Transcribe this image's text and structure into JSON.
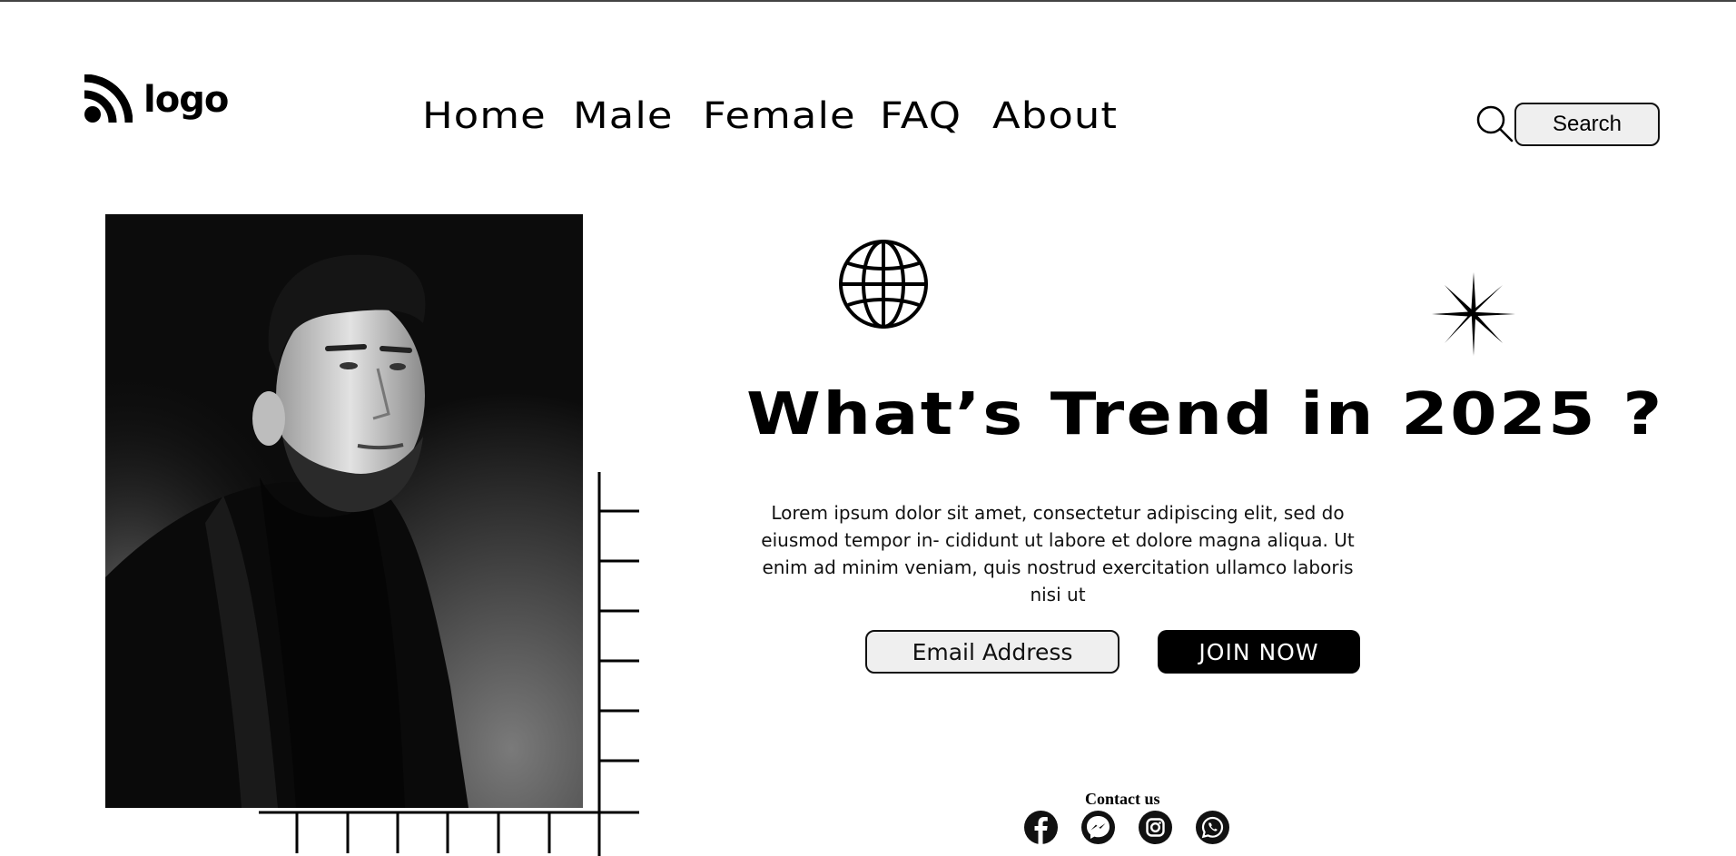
{
  "brand": {
    "logo_text": "logo"
  },
  "nav": {
    "items": [
      {
        "label": "Home"
      },
      {
        "label": "Male"
      },
      {
        "label": "Female"
      },
      {
        "label": "FAQ"
      },
      {
        "label": "About"
      }
    ]
  },
  "search": {
    "button_label": "Search",
    "icon": "search-icon"
  },
  "hero": {
    "headline": "What’s Trend in 2025 ?",
    "paragraph": "Lorem ipsum dolor sit amet, consectetur adipiscing elit, sed do eiusmod tempor in- cididunt ut labore et dolore magna aliqua. Ut enim ad minim veniam, quis nostrud exercitation ullamco laboris nisi ut",
    "email_placeholder": "Email Address",
    "join_label": "JOIN NOW",
    "decor_icons": [
      "globe-icon",
      "sparkle-star-icon"
    ]
  },
  "contact": {
    "label": "Contact us",
    "icons": [
      "facebook-icon",
      "messenger-icon",
      "instagram-icon",
      "whatsapp-icon"
    ]
  },
  "colors": {
    "background": "#ffffff",
    "text": "#000000",
    "button_fill": "#000000",
    "input_fill": "#efefef"
  }
}
